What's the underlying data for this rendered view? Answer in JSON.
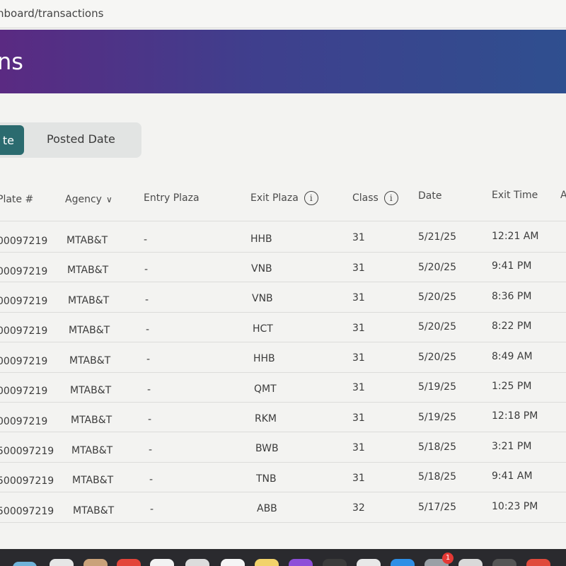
{
  "browser": {
    "url": "nboard/transactions"
  },
  "header": {
    "title": "ns"
  },
  "toggle": {
    "active_label": "te",
    "other_label": "Posted Date"
  },
  "table": {
    "columns": [
      {
        "key": "plate",
        "label": "Plate #"
      },
      {
        "key": "agency",
        "label": "Agency"
      },
      {
        "key": "entry",
        "label": "Entry Plaza"
      },
      {
        "key": "exit",
        "label": "Exit Plaza"
      },
      {
        "key": "class",
        "label": "Class"
      },
      {
        "key": "date",
        "label": "Date"
      },
      {
        "key": "exit_time",
        "label": "Exit Time"
      },
      {
        "key": "extra",
        "label": "A"
      }
    ],
    "rows": [
      {
        "plate": "00097219",
        "agency": "MTAB&T",
        "entry": "-",
        "exit": "HHB",
        "class": "31",
        "date": "5/21/25",
        "exit_time": "12:21 AM"
      },
      {
        "plate": "00097219",
        "agency": "MTAB&T",
        "entry": "-",
        "exit": "VNB",
        "class": "31",
        "date": "5/20/25",
        "exit_time": "9:41 PM"
      },
      {
        "plate": "00097219",
        "agency": "MTAB&T",
        "entry": "-",
        "exit": "VNB",
        "class": "31",
        "date": "5/20/25",
        "exit_time": "8:36 PM"
      },
      {
        "plate": "00097219",
        "agency": "MTAB&T",
        "entry": "-",
        "exit": "HCT",
        "class": "31",
        "date": "5/20/25",
        "exit_time": "8:22 PM"
      },
      {
        "plate": "00097219",
        "agency": "MTAB&T",
        "entry": "-",
        "exit": "HHB",
        "class": "31",
        "date": "5/20/25",
        "exit_time": "8:49 AM"
      },
      {
        "plate": "00097219",
        "agency": "MTAB&T",
        "entry": "-",
        "exit": "QMT",
        "class": "31",
        "date": "5/19/25",
        "exit_time": "1:25 PM"
      },
      {
        "plate": "00097219",
        "agency": "MTAB&T",
        "entry": "-",
        "exit": "RKM",
        "class": "31",
        "date": "5/19/25",
        "exit_time": "12:18 PM"
      },
      {
        "plate": "500097219",
        "agency": "MTAB&T",
        "entry": "-",
        "exit": "BWB",
        "class": "31",
        "date": "5/18/25",
        "exit_time": "3:21 PM"
      },
      {
        "plate": "500097219",
        "agency": "MTAB&T",
        "entry": "-",
        "exit": "TNB",
        "class": "31",
        "date": "5/18/25",
        "exit_time": "9:41 AM"
      },
      {
        "plate": "500097219",
        "agency": "MTAB&T",
        "entry": "-",
        "exit": "ABB",
        "class": "32",
        "date": "5/17/25",
        "exit_time": "10:23 PM"
      }
    ]
  },
  "icons": {
    "info": "info-icon",
    "sort": "chevron-down-icon"
  },
  "dock": {
    "badge_count": "1"
  },
  "colors": {
    "header_start": "#5a2a82",
    "header_end": "#2f4f8f",
    "toggle_active": "#2b6b6f"
  }
}
